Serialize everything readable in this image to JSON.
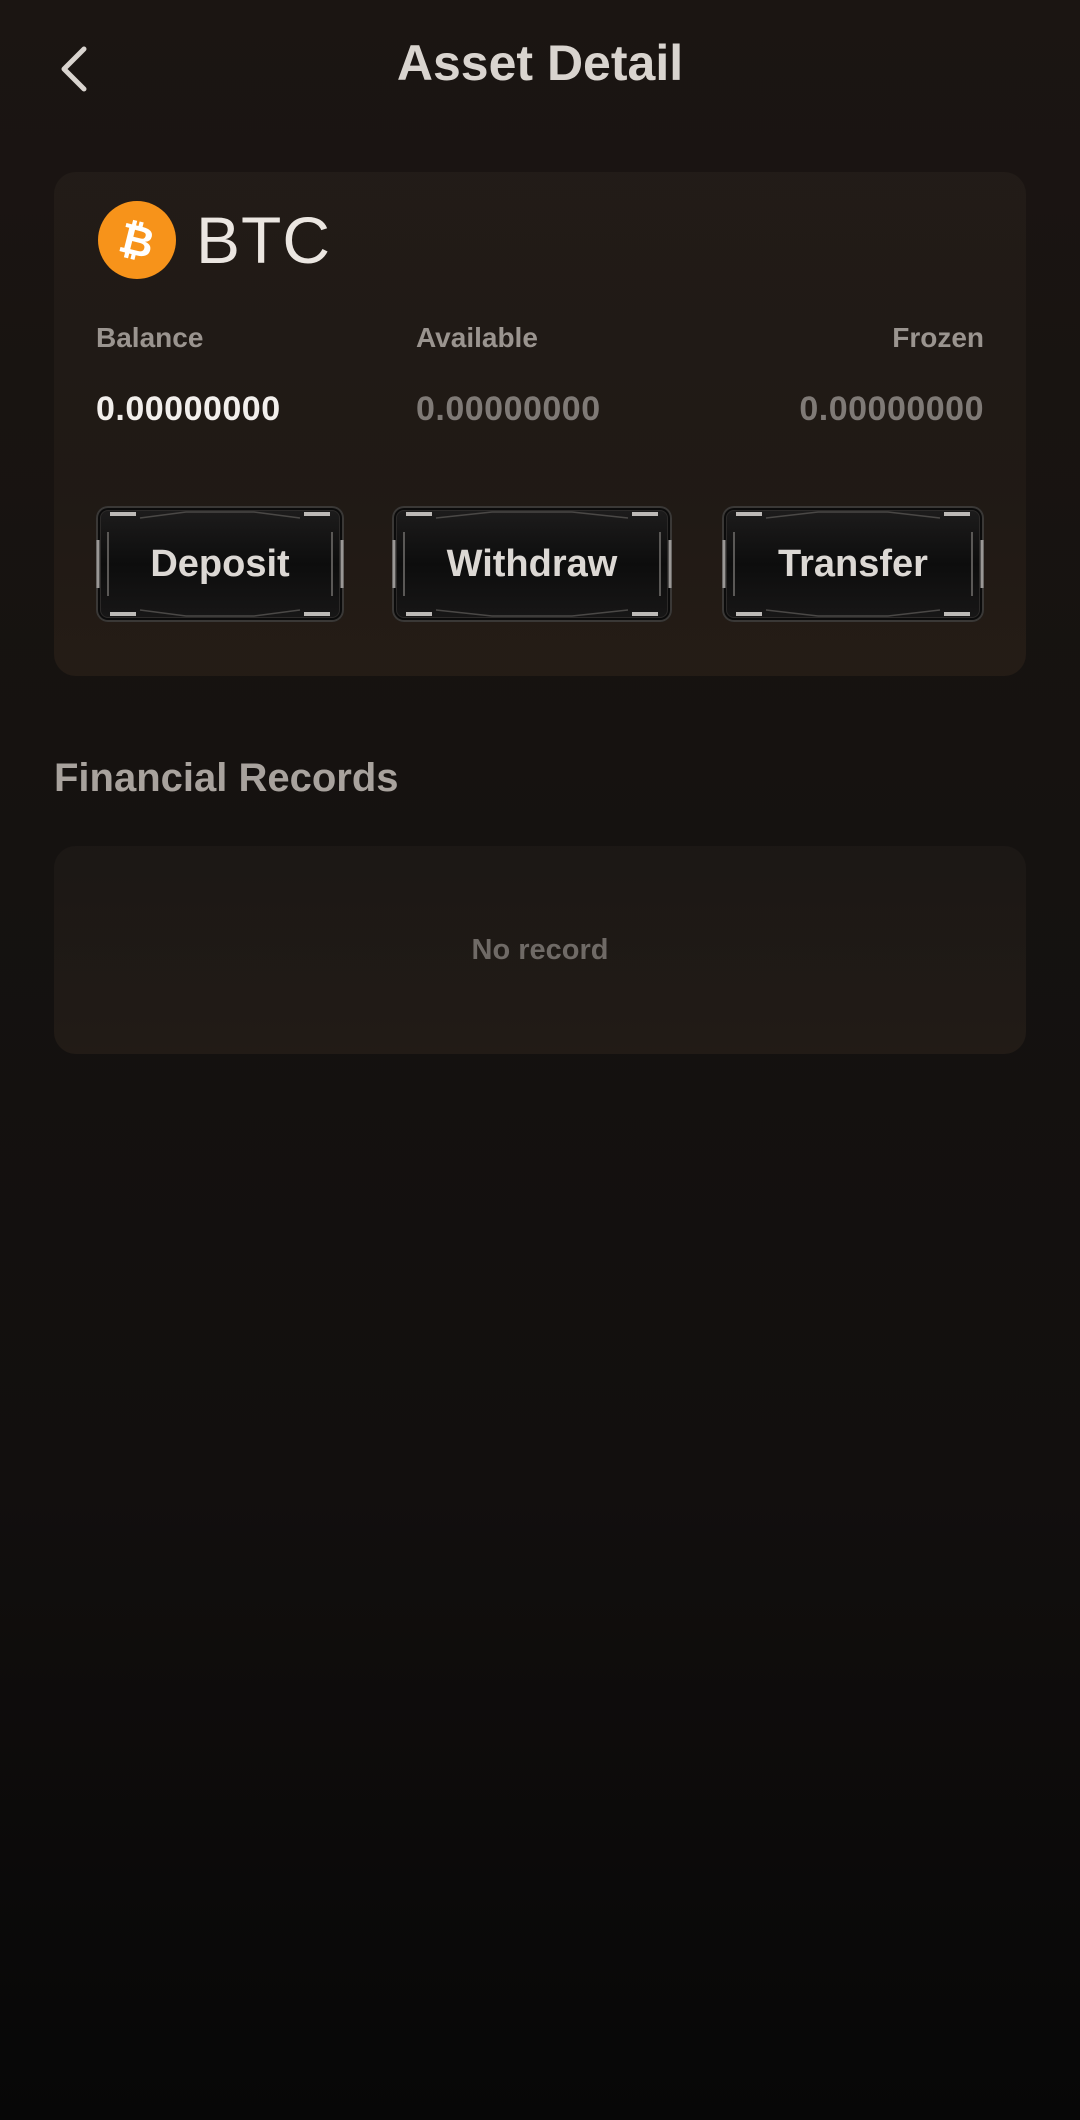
{
  "header": {
    "title": "Asset Detail",
    "back_icon": "chevron-left-icon"
  },
  "asset": {
    "symbol": "BTC",
    "logo_icon": "bitcoin-icon",
    "logo_color": "#f7931a",
    "stats": {
      "balance_label": "Balance",
      "balance_value": "0.00000000",
      "available_label": "Available",
      "available_value": "0.00000000",
      "frozen_label": "Frozen",
      "frozen_value": "0.00000000"
    },
    "actions": {
      "deposit_label": "Deposit",
      "withdraw_label": "Withdraw",
      "transfer_label": "Transfer"
    }
  },
  "records": {
    "title": "Financial Records",
    "empty_text": "No record"
  }
}
